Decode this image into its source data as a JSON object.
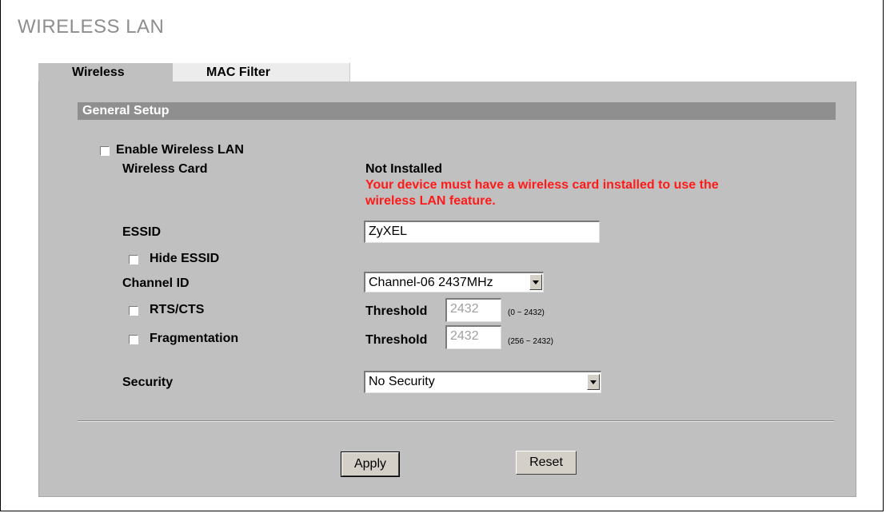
{
  "page": {
    "title": "WIRELESS LAN"
  },
  "tabs": [
    {
      "label": "Wireless",
      "active": true
    },
    {
      "label": "MAC Filter",
      "active": false
    }
  ],
  "section": {
    "title": "General Setup"
  },
  "form": {
    "enable_wireless": {
      "label": "Enable Wireless LAN",
      "checked": false
    },
    "wireless_card": {
      "label": "Wireless Card",
      "value": "Not Installed",
      "warning_line1": "Your device must have a wireless card installed to use the",
      "warning_line2": "wireless LAN feature.",
      "warning_color": "#ff1a1a"
    },
    "essid": {
      "label": "ESSID",
      "value": "ZyXEL"
    },
    "hide_essid": {
      "label": "Hide ESSID",
      "checked": false
    },
    "channel_id": {
      "label": "Channel ID",
      "selected": "Channel-06 2437MHz"
    },
    "rts_cts": {
      "label": "RTS/CTS",
      "checked": false,
      "threshold_label": "Threshold",
      "threshold_value": "2432",
      "range": "(0 ~ 2432)"
    },
    "fragmentation": {
      "label": "Fragmentation",
      "checked": false,
      "threshold_label": "Threshold",
      "threshold_value": "2432",
      "range": "(256 ~ 2432)"
    },
    "security": {
      "label": "Security",
      "selected": "No Security"
    }
  },
  "buttons": {
    "apply": "Apply",
    "reset": "Reset"
  },
  "colors": {
    "panel": "#c0c0c0",
    "section_header": "#8f8f8f",
    "title": "#8e8e8e"
  }
}
